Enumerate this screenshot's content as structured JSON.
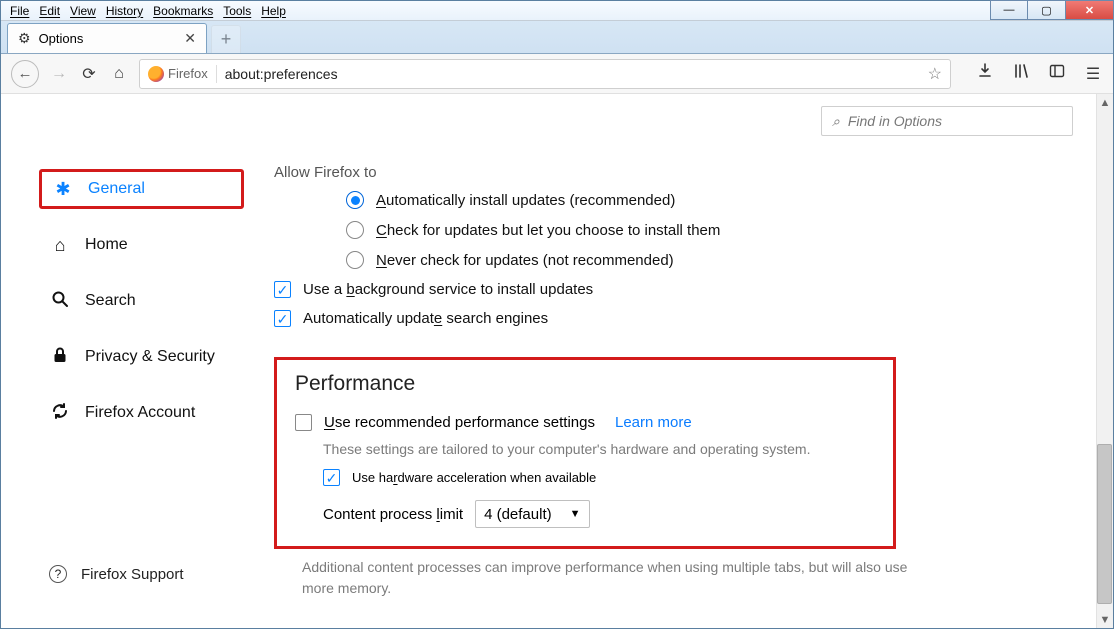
{
  "menubar": [
    "File",
    "Edit",
    "View",
    "History",
    "Bookmarks",
    "Tools",
    "Help"
  ],
  "tab": {
    "title": "Options"
  },
  "addressbar": {
    "identity": "Firefox",
    "url": "about:preferences"
  },
  "sidebar": {
    "items": [
      {
        "label": "General",
        "active": true
      },
      {
        "label": "Home"
      },
      {
        "label": "Search"
      },
      {
        "label": "Privacy & Security"
      },
      {
        "label": "Firefox Account"
      }
    ],
    "support": "Firefox Support"
  },
  "searchbox": {
    "placeholder": "Find in Options"
  },
  "updates": {
    "heading_clipped": "Allow Firefox to",
    "radios": [
      {
        "label": "Automatically install updates (recommended)",
        "ul": "A",
        "selected": true
      },
      {
        "label": "Check for updates but let you choose to install them",
        "ul": "C"
      },
      {
        "label": "Never check for updates (not recommended)",
        "ul": "N"
      }
    ],
    "checks": [
      {
        "label": "Use a background service to install updates",
        "ul": "b",
        "on": true
      },
      {
        "label": "Automatically update search engines",
        "ul": "e",
        "on": true
      }
    ]
  },
  "performance": {
    "title": "Performance",
    "use_recommended": {
      "label": "Use recommended performance settings",
      "ul": "U",
      "on": false
    },
    "learn_more": "Learn more",
    "subtext": "These settings are tailored to your computer's hardware and operating system.",
    "hw_accel": {
      "label": "Use hardware acceleration when available",
      "ul": "r",
      "on": true
    },
    "content_limit": {
      "label": "Content process limit",
      "ul": "l",
      "value": "4 (default)"
    },
    "footer": "Additional content processes can improve performance when using multiple tabs, but will also use more memory."
  }
}
